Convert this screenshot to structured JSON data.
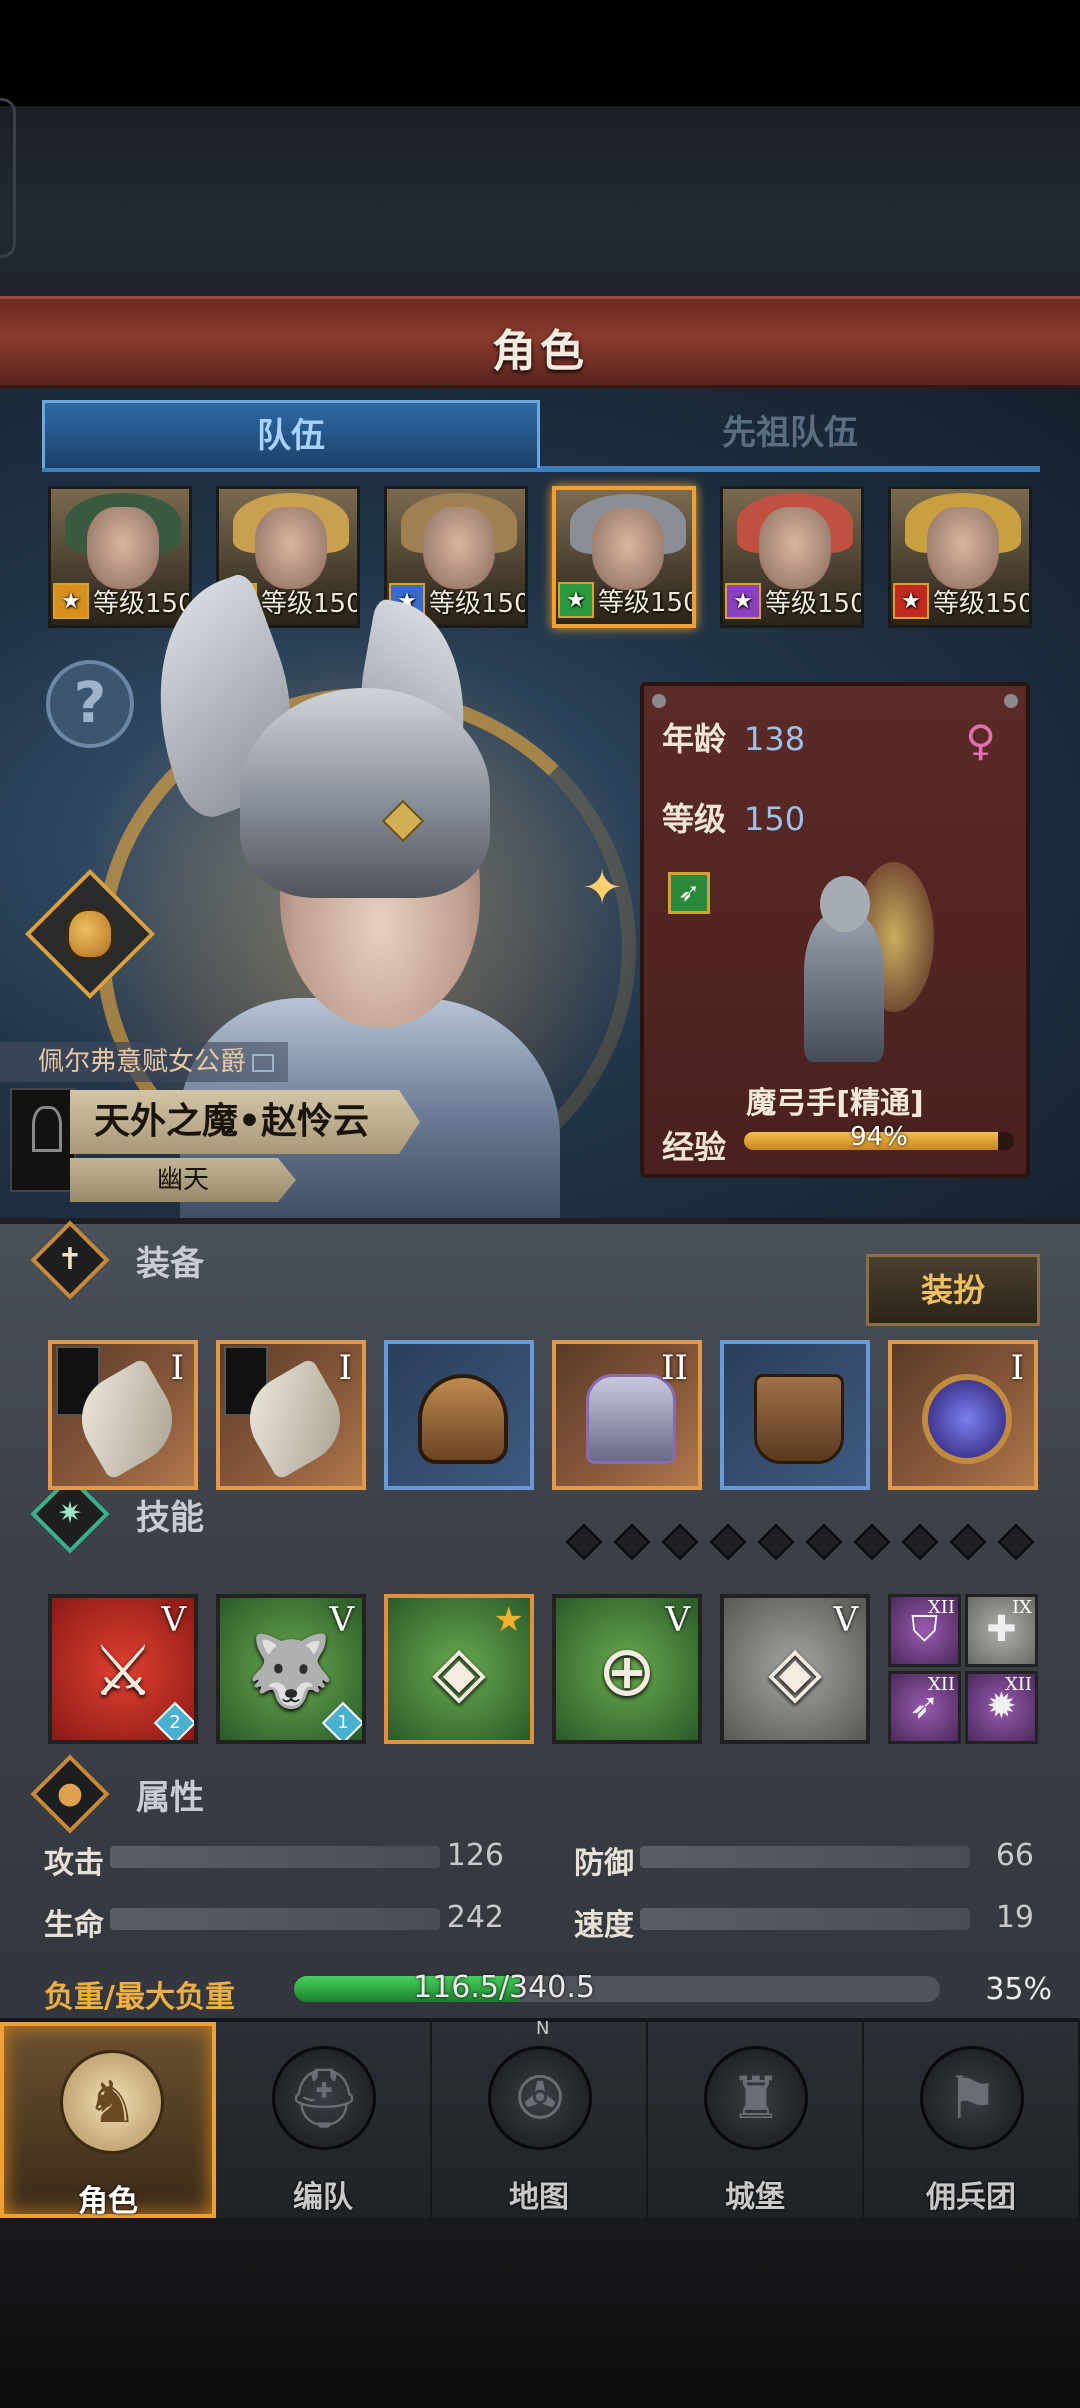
{
  "header": {
    "title": "角色"
  },
  "tabs": [
    {
      "label": "队伍",
      "active": true
    },
    {
      "label": "先祖队伍",
      "active": false
    }
  ],
  "party": [
    {
      "level_label": "等级150",
      "class_icon": "shield-class-icon",
      "class_color": "#d8901c",
      "hair_color": "#3a5a40",
      "selected": false
    },
    {
      "level_label": "等级150",
      "class_icon": "shield-class-icon",
      "class_color": "#d8901c",
      "hair_color": "#c8a050",
      "selected": false
    },
    {
      "level_label": "等级150",
      "class_icon": "sword-class-icon",
      "class_color": "#3a6ad0",
      "hair_color": "#a08050",
      "selected": false
    },
    {
      "level_label": "等级150",
      "class_icon": "bow-class-icon",
      "class_color": "#2a9a40",
      "hair_color": "#8a8e96",
      "selected": true
    },
    {
      "level_label": "等级150",
      "class_icon": "staff-class-icon",
      "class_color": "#8a40c0",
      "hair_color": "#c05040",
      "selected": false
    },
    {
      "level_label": "等级150",
      "class_icon": "horse-class-icon",
      "class_color": "#c02a20",
      "hair_color": "#c8a040",
      "selected": false
    }
  ],
  "character": {
    "title": "佩尔弗意赋女公爵",
    "name": "天外之魔•赵怜云",
    "faction": "幽天",
    "age_label": "年龄",
    "age": "138",
    "level_label": "等级",
    "level": "150",
    "gender_icon": "female-icon",
    "job": "魔弓手[精通]",
    "exp_label": "经验",
    "exp_percent_text": "94%",
    "exp_fraction": 0.94
  },
  "equipment": {
    "label": "装备",
    "dress_button": "装扮",
    "slots": [
      {
        "name": "weapon-slot-1",
        "tier": "I",
        "rarity": "orange",
        "flag": true,
        "icon": "winged-bow-icon"
      },
      {
        "name": "weapon-slot-2",
        "tier": "I",
        "rarity": "orange",
        "flag": true,
        "icon": "winged-bow-icon"
      },
      {
        "name": "helmet-slot",
        "tier": "",
        "rarity": "blue",
        "flag": false,
        "icon": "helmet-icon"
      },
      {
        "name": "armor-slot",
        "tier": "II",
        "rarity": "orange",
        "flag": false,
        "icon": "armor-icon"
      },
      {
        "name": "boots-slot",
        "tier": "",
        "rarity": "blue",
        "flag": false,
        "icon": "boots-icon"
      },
      {
        "name": "accessory-slot",
        "tier": "I",
        "rarity": "orange",
        "flag": false,
        "icon": "orb-icon"
      }
    ]
  },
  "skills": {
    "label": "技能",
    "pip_count": 10,
    "main": [
      {
        "name": "skill-sword-strike",
        "tier": "V",
        "color": "red",
        "glyph": "⚔",
        "gem": "2",
        "star": false
      },
      {
        "name": "skill-wolf",
        "tier": "V",
        "color": "green",
        "glyph": "🐺",
        "gem": "1",
        "star": false
      },
      {
        "name": "skill-crystal-spear",
        "tier": "",
        "color": "green",
        "glyph": "◈",
        "gem": "",
        "star": true
      },
      {
        "name": "skill-target",
        "tier": "V",
        "color": "green",
        "glyph": "⊕",
        "gem": "",
        "star": false
      },
      {
        "name": "skill-crystal-hand",
        "tier": "V",
        "color": "grey",
        "glyph": "◈",
        "gem": "",
        "star": false
      }
    ],
    "mini": [
      {
        "name": "skill-shield",
        "tier": "XII",
        "color": "purple",
        "glyph": "⛉"
      },
      {
        "name": "skill-heal",
        "tier": "IX",
        "color": "grey",
        "glyph": "✚"
      },
      {
        "name": "skill-arrow",
        "tier": "XII",
        "color": "purple",
        "glyph": "➶"
      },
      {
        "name": "skill-sun",
        "tier": "XII",
        "color": "purple",
        "glyph": "✹"
      }
    ]
  },
  "attributes": {
    "label": "属性",
    "stats": [
      {
        "label": "攻击",
        "value": "126"
      },
      {
        "label": "防御",
        "value": "66"
      },
      {
        "label": "生命",
        "value": "242"
      },
      {
        "label": "速度",
        "value": "19"
      }
    ],
    "load_label": "负重/最大负重",
    "load_text": "116.5/340.5",
    "load_percent": "35%",
    "load_fraction": 0.35
  },
  "nav": [
    {
      "label": "角色",
      "icon": "knight-icon",
      "glyph": "♞",
      "active": true
    },
    {
      "label": "编队",
      "icon": "helmet-formation-icon",
      "glyph": "⛑",
      "active": false
    },
    {
      "label": "地图",
      "icon": "compass-map-icon",
      "glyph": "✇",
      "active": false
    },
    {
      "label": "城堡",
      "icon": "castle-icon",
      "glyph": "♜",
      "active": false
    },
    {
      "label": "佣兵团",
      "icon": "mercenary-icon",
      "glyph": "⚑",
      "active": false
    }
  ],
  "compass_letter": "N",
  "help_glyph": "?",
  "female_glyph": "♀",
  "colors": {
    "accent_orange": "#f0a030",
    "exp_gold": "#f6c050",
    "load_green": "#46d05a",
    "banner_red": "#8a3a2d",
    "tab_blue": "#2d6aa6"
  }
}
